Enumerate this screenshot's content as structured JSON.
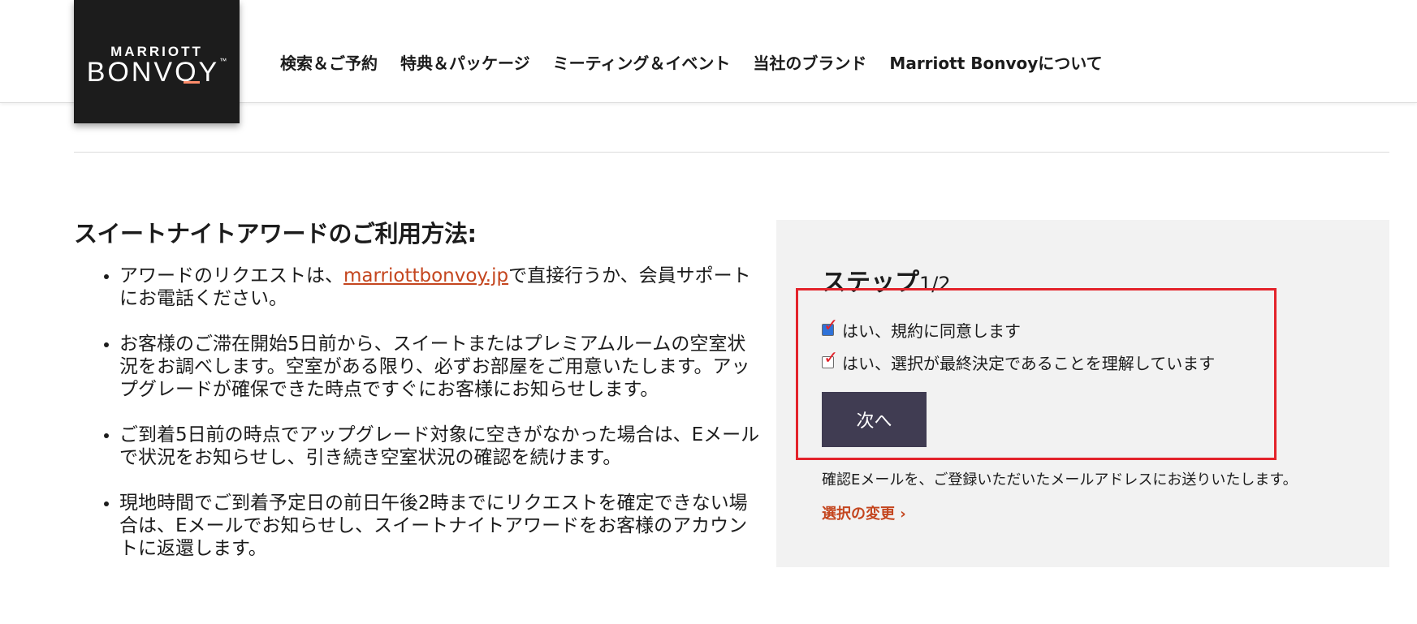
{
  "brand": {
    "logo_top": "MARRIOTT",
    "logo_main": "BONVOY",
    "tm": "™",
    "accent_color": "#ff8d6b"
  },
  "header": {
    "nav": [
      {
        "label": "検索＆ご予約"
      },
      {
        "label": "特典＆パッケージ"
      },
      {
        "label": "ミーティング＆イベント"
      },
      {
        "label": "当社のブランド"
      },
      {
        "label": "Marriott Bonvoyについて"
      }
    ]
  },
  "main": {
    "heading": "スイートナイトアワードのご利用方法:",
    "bullets": [
      {
        "pre": "アワードのリクエストは、",
        "link": "marriottbonvoy.jp",
        "post": "で直接行うか、会員サポートにお電話ください。"
      },
      {
        "text": "お客様のご滞在開始5日前から、スイートまたはプレミアムルームの空室状況をお調べします。空室がある限り、必ずお部屋をご用意いたします。アップグレードが確保できた時点ですぐにお客様にお知らせします。"
      },
      {
        "text": "ご到着5日前の時点でアップグレード対象に空きがなかった場合は、Eメールで状況をお知らせし、引き続き空室状況の確認を続けます。"
      },
      {
        "text": "現地時間でご到着予定日の前日午後2時までにリクエストを確定できない場合は、Eメールでお知らせし、スイートナイトアワードをお客様のアカウントに返還します。"
      }
    ]
  },
  "panel": {
    "step_title": "ステップ",
    "step_num": "1/2",
    "check1_label": "はい、規約に同意します",
    "check2_label": "はい、選択が最終決定であることを理解しています",
    "next_label": "次へ",
    "note": "確認Eメールを、ご登録いただいたメールアドレスにお送りいたします。",
    "change_link": "選択の変更 ›",
    "link_color": "#c4461f",
    "highlight_color": "#e3232b",
    "button_color": "#403c52"
  }
}
